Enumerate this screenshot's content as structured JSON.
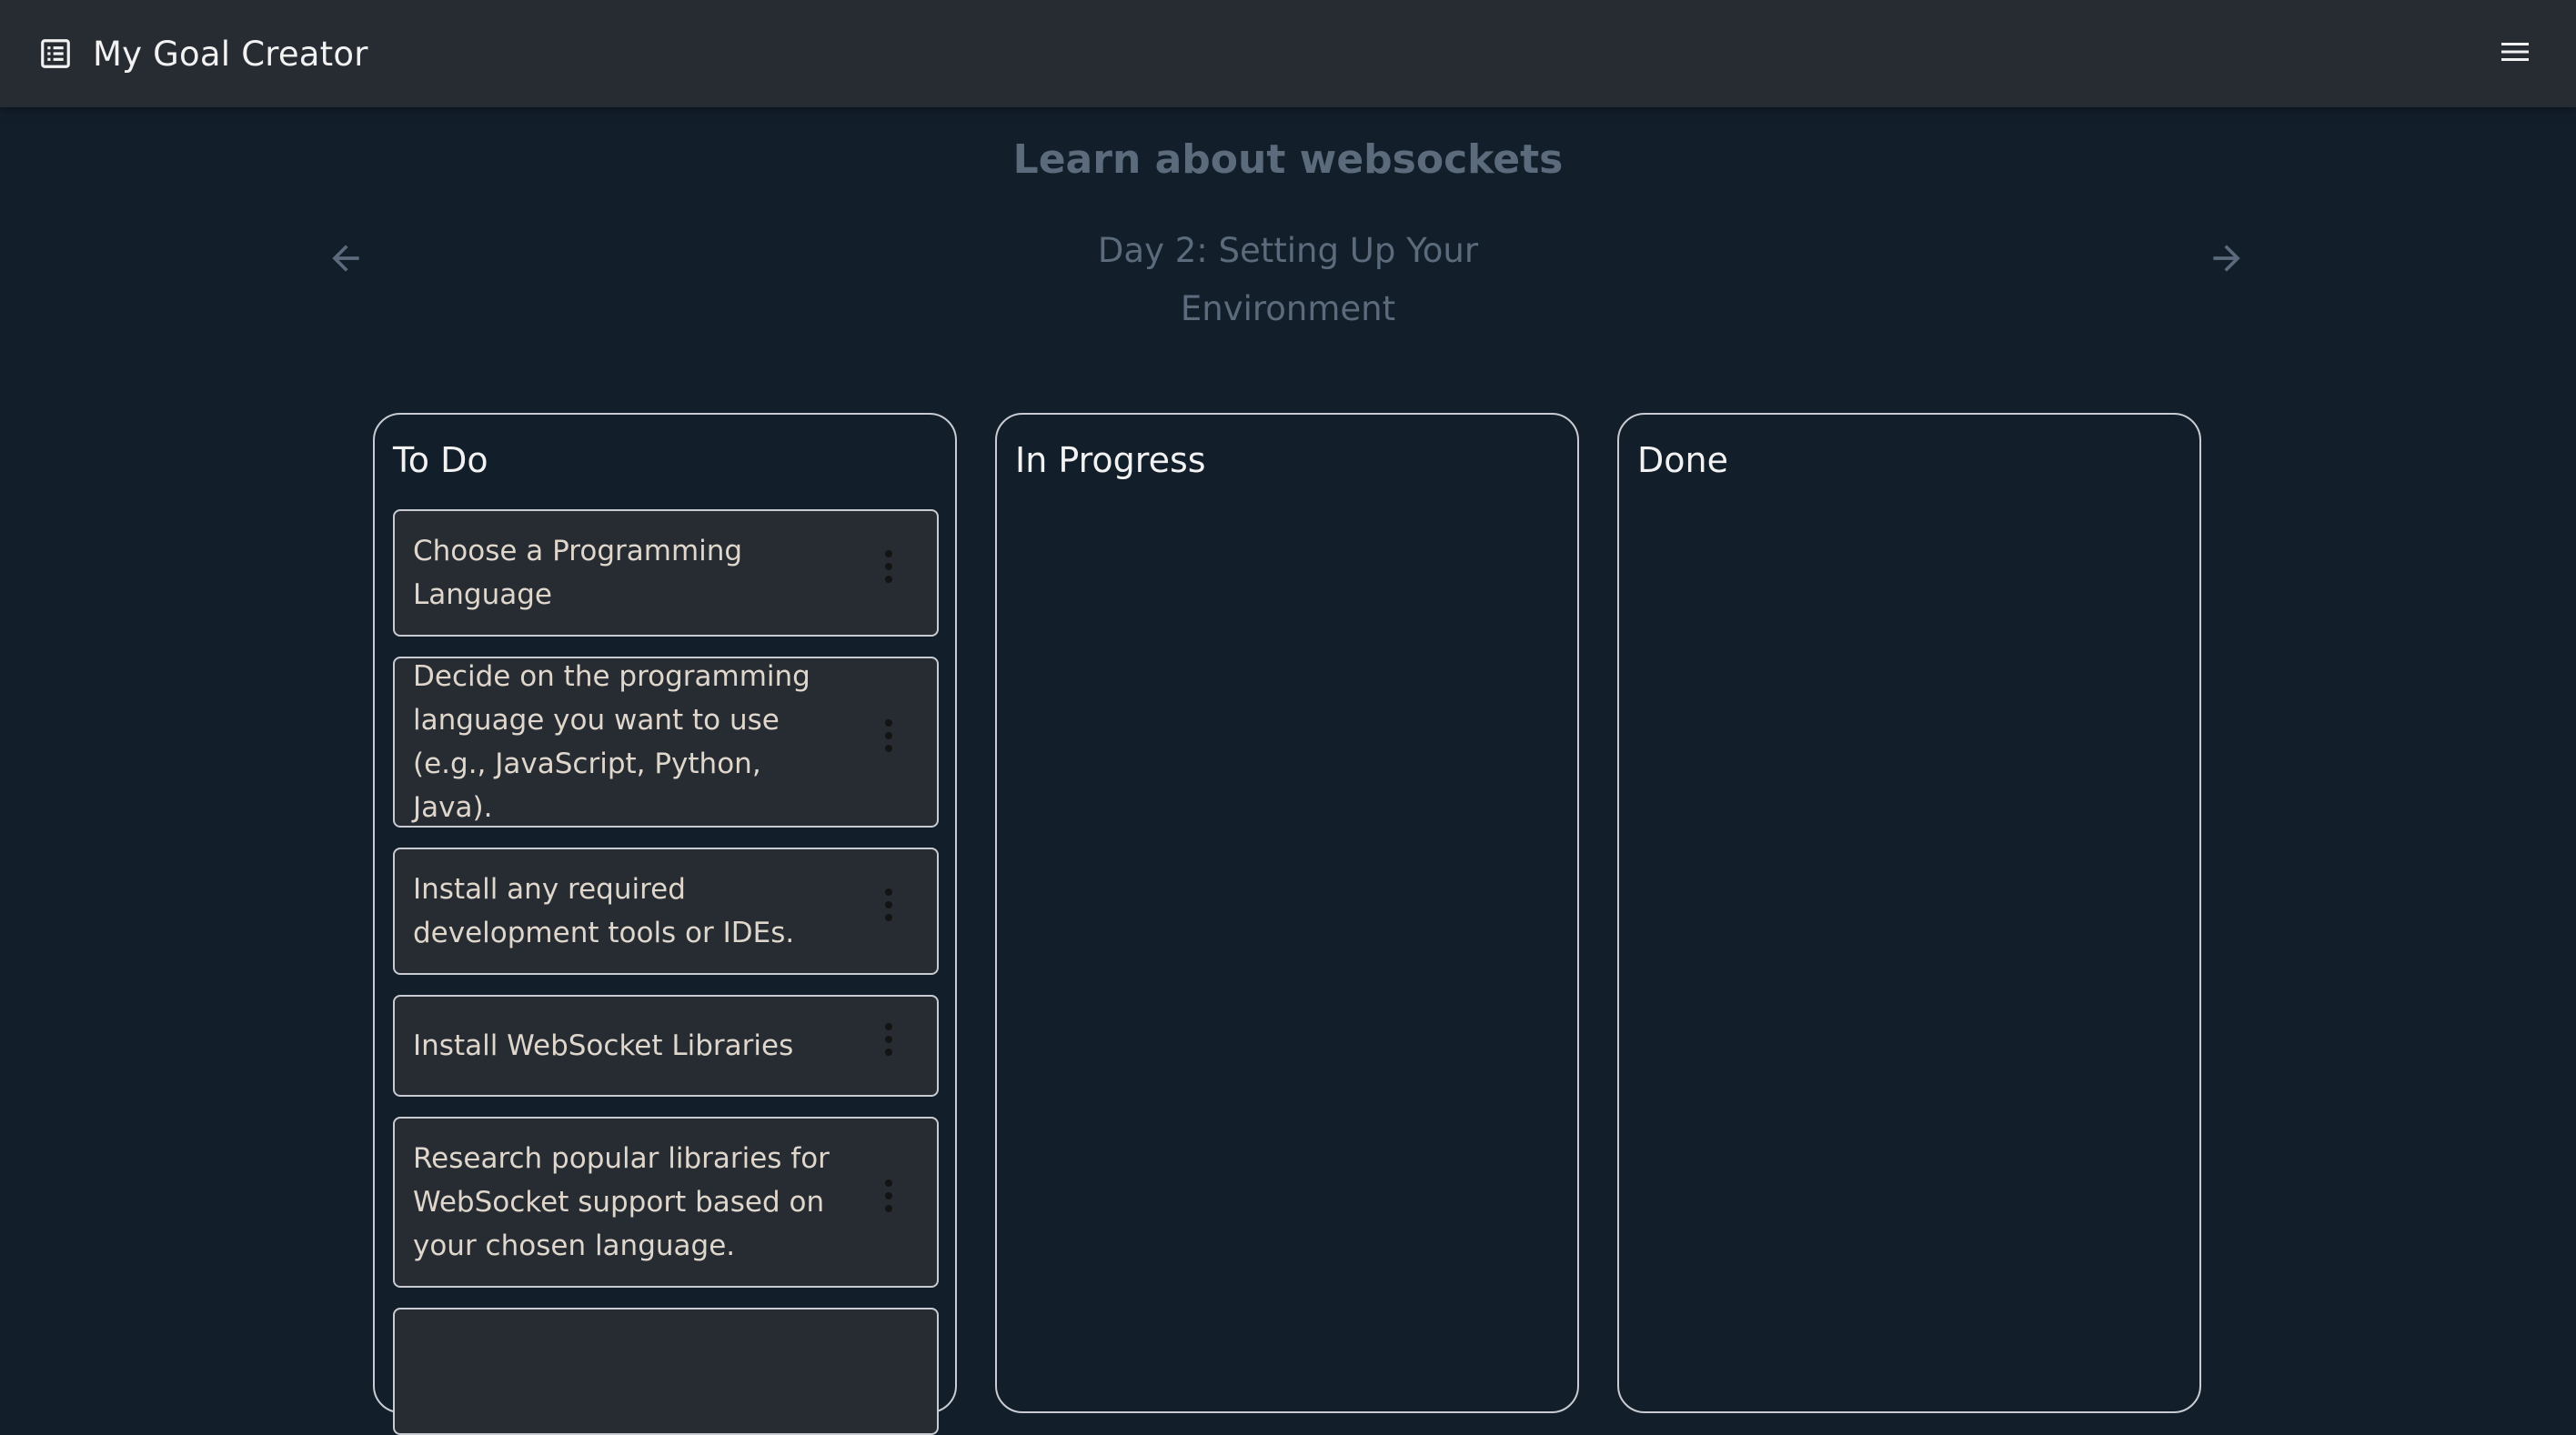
{
  "app": {
    "title": "My Goal Creator",
    "icon": "list-alt-icon",
    "menu_icon": "hamburger-menu-icon"
  },
  "goal": {
    "title": "Learn about websockets"
  },
  "day": {
    "title": "Day 2: Setting Up Your Environment",
    "prev_icon": "arrow-left-icon",
    "next_icon": "arrow-right-icon"
  },
  "columns": [
    {
      "title": "To Do",
      "tasks": [
        {
          "text": "Choose a Programming Language"
        },
        {
          "text": "Decide on the programming language you want to use (e.g., JavaScript, Python, Java)."
        },
        {
          "text": "Install any required development tools or IDEs."
        },
        {
          "text": "Install WebSocket Libraries"
        },
        {
          "text": "Research popular libraries for WebSocket support based on your chosen language."
        },
        {
          "text": ""
        }
      ]
    },
    {
      "title": "In Progress",
      "tasks": []
    },
    {
      "title": "Done",
      "tasks": []
    }
  ],
  "colors": {
    "background": "#121e2a",
    "appbar": "#272c33",
    "card": "#272c33",
    "border": "#c8ccd2",
    "muted_text": "#5b6b7c",
    "card_text": "#dfd6cc"
  }
}
